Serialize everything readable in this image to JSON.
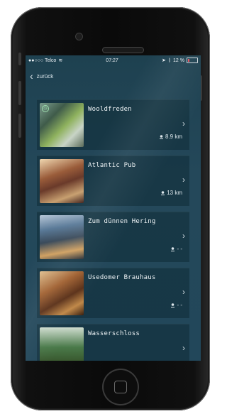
{
  "status": {
    "carrier": "●●○○○ Telco",
    "time": "07:27",
    "battery": "12 %"
  },
  "nav": {
    "back_label": "zurück"
  },
  "places": [
    {
      "name": "Wooldfreden",
      "distance": "8.9 km"
    },
    {
      "name": "Atlantic Pub",
      "distance": "13 km"
    },
    {
      "name": "Zum dünnen Hering",
      "distance": "- -"
    },
    {
      "name": "Usedomer Brauhaus",
      "distance": "- -"
    },
    {
      "name": "Wasserschloss",
      "distance": ""
    }
  ]
}
